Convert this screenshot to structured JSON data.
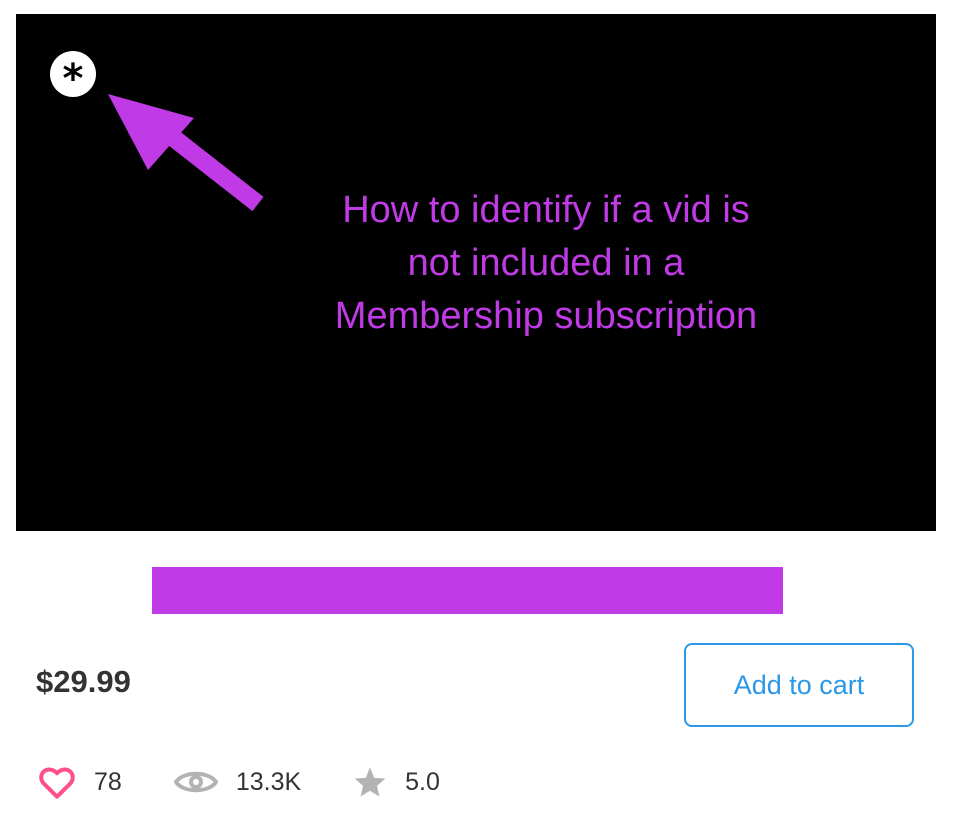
{
  "thumbnail": {
    "badge_symbol": "*",
    "overlay_lines": [
      "How to identify if a vid is",
      "not included in a",
      "Membership subscription"
    ],
    "overlay_color": "#c03ae6",
    "arrow_icon": "arrow-up-left-icon"
  },
  "title_redaction_color": "#c03ae6",
  "price": "$29.99",
  "add_to_cart_label": "Add to cart",
  "accent_color": "#2b97e6",
  "stats": {
    "likes": "78",
    "views": "13.3K",
    "rating": "5.0",
    "like_icon": "heart-icon",
    "views_icon": "eye-icon",
    "rating_icon": "star-icon",
    "like_color": "#ff4f8b"
  }
}
